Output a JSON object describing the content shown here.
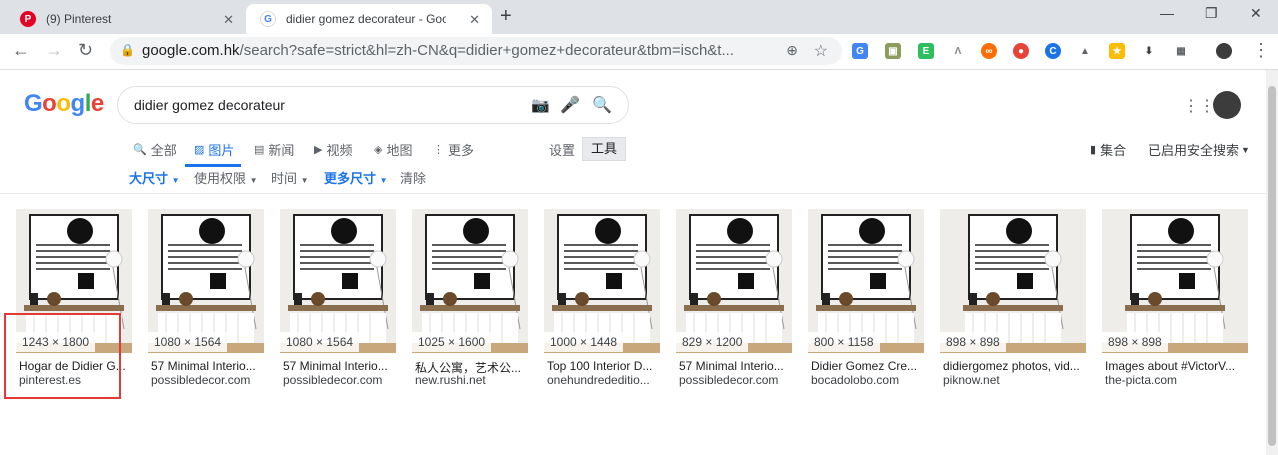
{
  "browser": {
    "tabs": [
      {
        "title": "(9) Pinterest",
        "active": false
      },
      {
        "title": "didier gomez decorateur - Goo",
        "active": true
      }
    ],
    "url_host": "google.com.hk",
    "url_rest": "/search?safe=strict&hl=zh-CN&q=didier+gomez+decorateur&tbm=isch&t..."
  },
  "google": {
    "logo": "Google",
    "query": "didier gomez decorateur",
    "tabs": [
      "全部",
      "图片",
      "新闻",
      "视频",
      "地图",
      "更多"
    ],
    "settings_label": "设置",
    "tools_label": "工具",
    "collections_label": "集合",
    "safesearch_label": "已启用安全搜索"
  },
  "filters": {
    "size": "大尺寸",
    "rights": "使用权限",
    "time": "时间",
    "more_sizes": "更多尺寸",
    "clear": "清除"
  },
  "results": [
    {
      "dims": "1243 × 1800",
      "title": "Hogar de Didier G...",
      "source": "pinterest.es"
    },
    {
      "dims": "1080 × 1564",
      "title": "57 Minimal Interio...",
      "source": "possibledecor.com"
    },
    {
      "dims": "1080 × 1564",
      "title": "57 Minimal Interio...",
      "source": "possibledecor.com"
    },
    {
      "dims": "1025 × 1600",
      "title": "私人公寓，艺术公...",
      "source": "new.rushi.net"
    },
    {
      "dims": "1000 × 1448",
      "title": "Top 100 Interior D...",
      "source": "onehundrededitio..."
    },
    {
      "dims": "829 × 1200",
      "title": "57 Minimal Interio...",
      "source": "possibledecor.com"
    },
    {
      "dims": "800 × 1158",
      "title": "Didier Gomez Cre...",
      "source": "bocadolobo.com"
    },
    {
      "dims": "898 × 898",
      "title": "didiergomez photos, vid...",
      "source": "piknow.net"
    },
    {
      "dims": "898 × 898",
      "title": "Images about #VictorV...",
      "source": "the-picta.com"
    }
  ]
}
